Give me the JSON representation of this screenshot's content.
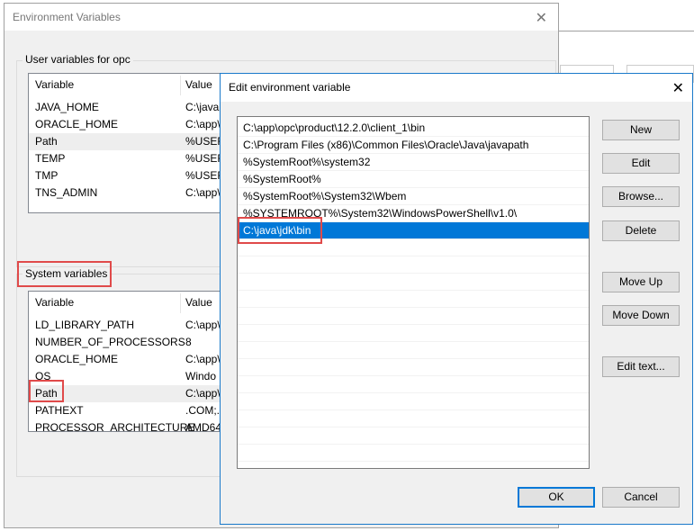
{
  "env_dialog": {
    "title": "Environment Variables",
    "user_group_label": "User variables for opc",
    "system_group_label": "System variables",
    "columns": [
      "Variable",
      "Value"
    ],
    "user_vars": [
      {
        "name": "JAVA_HOME",
        "value": "C:\\java"
      },
      {
        "name": "ORACLE_HOME",
        "value": "C:\\app\\"
      },
      {
        "name": "Path",
        "value": "%USER"
      },
      {
        "name": "TEMP",
        "value": "%USER"
      },
      {
        "name": "TMP",
        "value": "%USER"
      },
      {
        "name": "TNS_ADMIN",
        "value": "C:\\app\\"
      }
    ],
    "system_vars": [
      {
        "name": "LD_LIBRARY_PATH",
        "value": "C:\\app\\"
      },
      {
        "name": "NUMBER_OF_PROCESSORS",
        "value": "8"
      },
      {
        "name": "ORACLE_HOME",
        "value": "C:\\app\\"
      },
      {
        "name": "OS",
        "value": "Windo"
      },
      {
        "name": "Path",
        "value": "C:\\app\\"
      },
      {
        "name": "PATHEXT",
        "value": ".COM;."
      },
      {
        "name": "PROCESSOR_ARCHITECTURE",
        "value": "AMD64"
      }
    ]
  },
  "edit_dialog": {
    "title": "Edit environment variable",
    "entries": [
      "C:\\app\\opc\\product\\12.2.0\\client_1\\bin",
      "C:\\Program Files (x86)\\Common Files\\Oracle\\Java\\javapath",
      "%SystemRoot%\\system32",
      "%SystemRoot%",
      "%SystemRoot%\\System32\\Wbem",
      "%SYSTEMROOT%\\System32\\WindowsPowerShell\\v1.0\\",
      "C:\\java\\jdk\\bin"
    ],
    "selected_index": 6,
    "buttons": {
      "new": "New",
      "edit": "Edit",
      "browse": "Browse...",
      "delete": "Delete",
      "move_up": "Move Up",
      "move_down": "Move Down",
      "edit_text": "Edit text...",
      "ok": "OK",
      "cancel": "Cancel"
    }
  },
  "colors": {
    "selection": "#0078d7",
    "highlight_box": "#e04a4a"
  }
}
